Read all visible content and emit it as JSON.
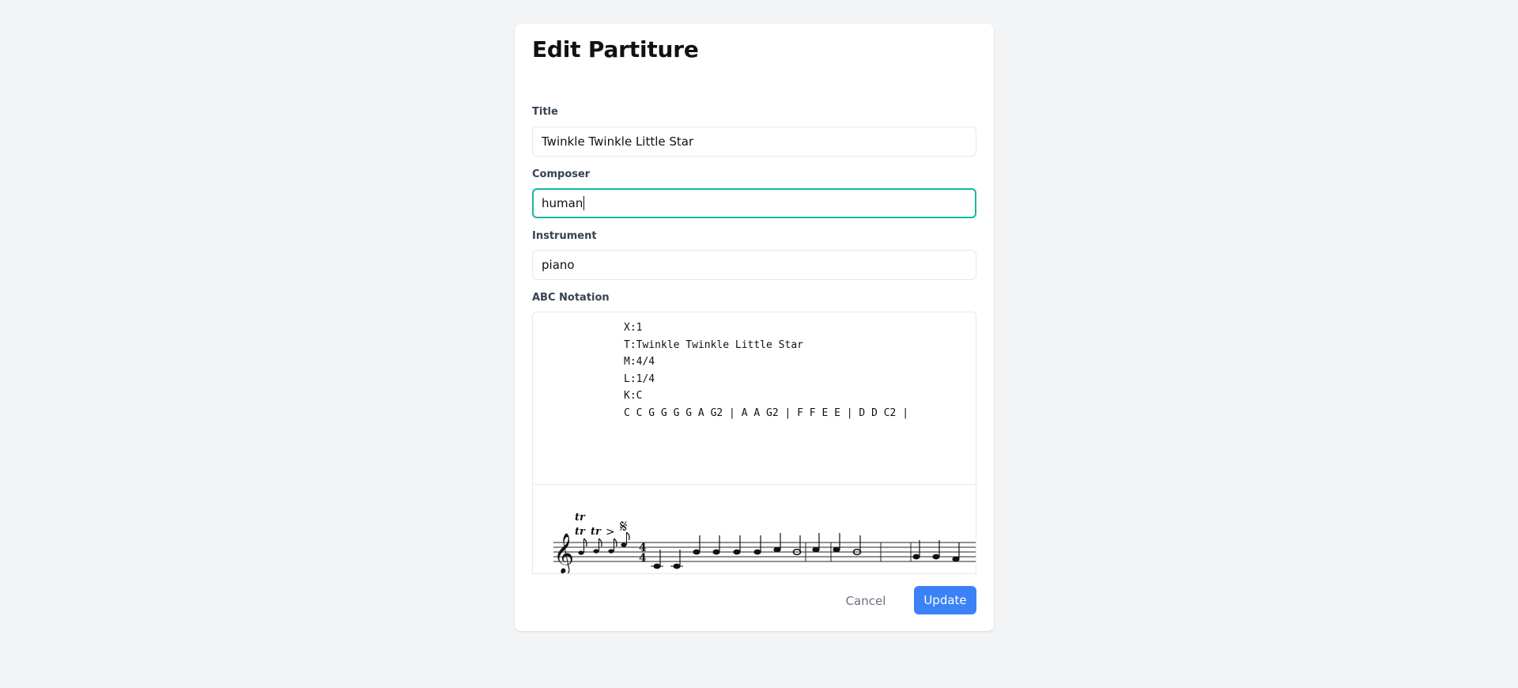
{
  "page": {
    "title": "Edit Partiture"
  },
  "fields": {
    "title": {
      "label": "Title",
      "value": "Twinkle Twinkle Little Star"
    },
    "composer": {
      "label": "Composer",
      "value": "human"
    },
    "instrument": {
      "label": "Instrument",
      "value": "piano"
    },
    "abc": {
      "label": "ABC Notation",
      "lines": [
        "X:1",
        "T:Twinkle Twinkle Little Star",
        "M:4/4",
        "L:1/4",
        "K:C",
        "C C G G G G A G2 | A A G2 | F F E E | D D C2 |"
      ]
    }
  },
  "preview": {
    "time_signature": {
      "numerator": "4",
      "denominator": "4"
    },
    "ornaments": [
      "tr",
      "tr",
      "tr",
      ">",
      "segno"
    ]
  },
  "buttons": {
    "cancel": "Cancel",
    "update": "Update"
  },
  "colors": {
    "background": "#f3f4f6",
    "focus_ring": "#14b8a6",
    "primary": "#3b82f6"
  }
}
